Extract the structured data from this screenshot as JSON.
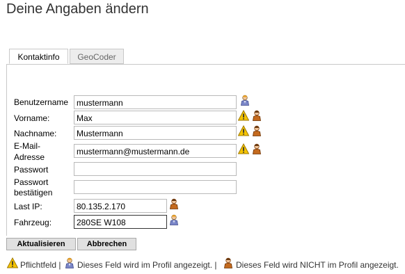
{
  "page": {
    "title": "Deine Angaben ändern"
  },
  "tabs": [
    {
      "label": "Kontaktinfo",
      "active": true
    },
    {
      "label": "GeoCoder",
      "active": false
    }
  ],
  "form": {
    "fields": [
      {
        "label": "Benutzername",
        "value": "mustermann",
        "icons": [
          "public-person-icon"
        ]
      },
      {
        "label": "Vorname:",
        "value": "Max",
        "icons": [
          "warning-icon",
          "private-person-icon"
        ]
      },
      {
        "label": "Nachname:",
        "value": "Mustermann",
        "icons": [
          "warning-icon",
          "private-person-icon"
        ]
      },
      {
        "label_line1": "E-Mail-",
        "label_line2": "Adresse",
        "value": "mustermann@mustermann.de",
        "icons": [
          "warning-icon",
          "private-person-icon"
        ]
      },
      {
        "label": "Passwort",
        "value": ""
      },
      {
        "label_line1": "Passwort",
        "label_line2": "bestätigen",
        "value": ""
      },
      {
        "label": "Last IP:",
        "value": "80.135.2.170",
        "icons": [
          "private-person-icon"
        ]
      },
      {
        "label": "Fahrzeug:",
        "value": "280SE W108",
        "icons": [
          "public-person-icon"
        ]
      }
    ]
  },
  "buttons": {
    "update": "Aktualisieren",
    "cancel": "Abbrechen"
  },
  "legend": {
    "required": "Pflichtfeld |",
    "public": "Dieses Feld wird im Profil angezeigt. |",
    "private": "Dieses Feld wird NICHT im Profil angezeigt."
  },
  "colors": {
    "warning": "#f5c400",
    "public_icon": "#7a86c8",
    "private_icon": "#c46a1e"
  }
}
